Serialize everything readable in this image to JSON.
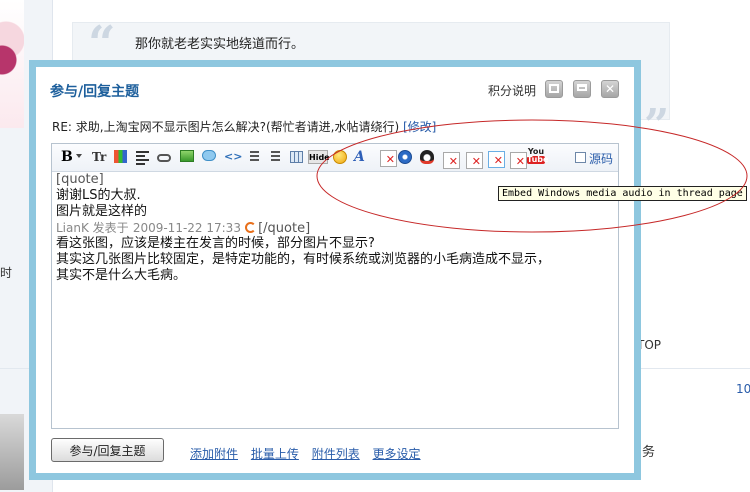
{
  "background": {
    "quote_line1": "那你就老老实实地绕道而行。",
    "sidebar_fragment": "时",
    "top_label": "TOP",
    "count_fragment": "10",
    "service_fragment": "务"
  },
  "modal": {
    "title": "参与/回复主题",
    "help_label": "积分说明",
    "subject_text": "RE: 求助,上淘宝网不显示图片怎么解决?(帮忙者请进,水帖请绕行)",
    "subject_edit_link": "[修改]"
  },
  "toolbar": {
    "bold_label": "B",
    "font_label": "Tr",
    "hide_label": "Hide",
    "font_style_label": "A",
    "youtube_label_top": "You",
    "youtube_label_bottom": "Tube",
    "source_label": "源码",
    "icons": [
      "bold-icon",
      "font-icon",
      "color-icon",
      "align-icon",
      "link-icon",
      "image-icon",
      "quote-icon",
      "code-icon",
      "ordered-list-icon",
      "unordered-list-icon",
      "table-icon",
      "hide-icon",
      "smiley-icon",
      "font-style-icon",
      "flash-icon",
      "compass-icon",
      "qq-icon",
      "broken-image-icon",
      "youtube-icon"
    ]
  },
  "tooltip": "Embed Windows media audio in thread page",
  "editor": {
    "lines": [
      "[quote]",
      "谢谢LS的大叔.",
      "图片就是这样的",
      "",
      "看这张图，应该是楼主在发言的时候，部分图片不显示?",
      "其实这几张图片比较固定，是特定功能的，有时候系统或浏览器的小毛病造成不显示，",
      "其实不是什么大毛病。"
    ],
    "meta_author": "LianK 发表于",
    "meta_time": "2009-11-22 17:33",
    "quote_end": "[/quote]"
  },
  "footer": {
    "submit_label": "参与/回复主题",
    "links": [
      "添加附件",
      "批量上传",
      "附件列表",
      "更多设定"
    ]
  },
  "colors": {
    "modal_border": "#8ec7df",
    "title_blue": "#1d5f9c",
    "link_blue": "#2a5daa",
    "annotation_red": "#c62828"
  }
}
